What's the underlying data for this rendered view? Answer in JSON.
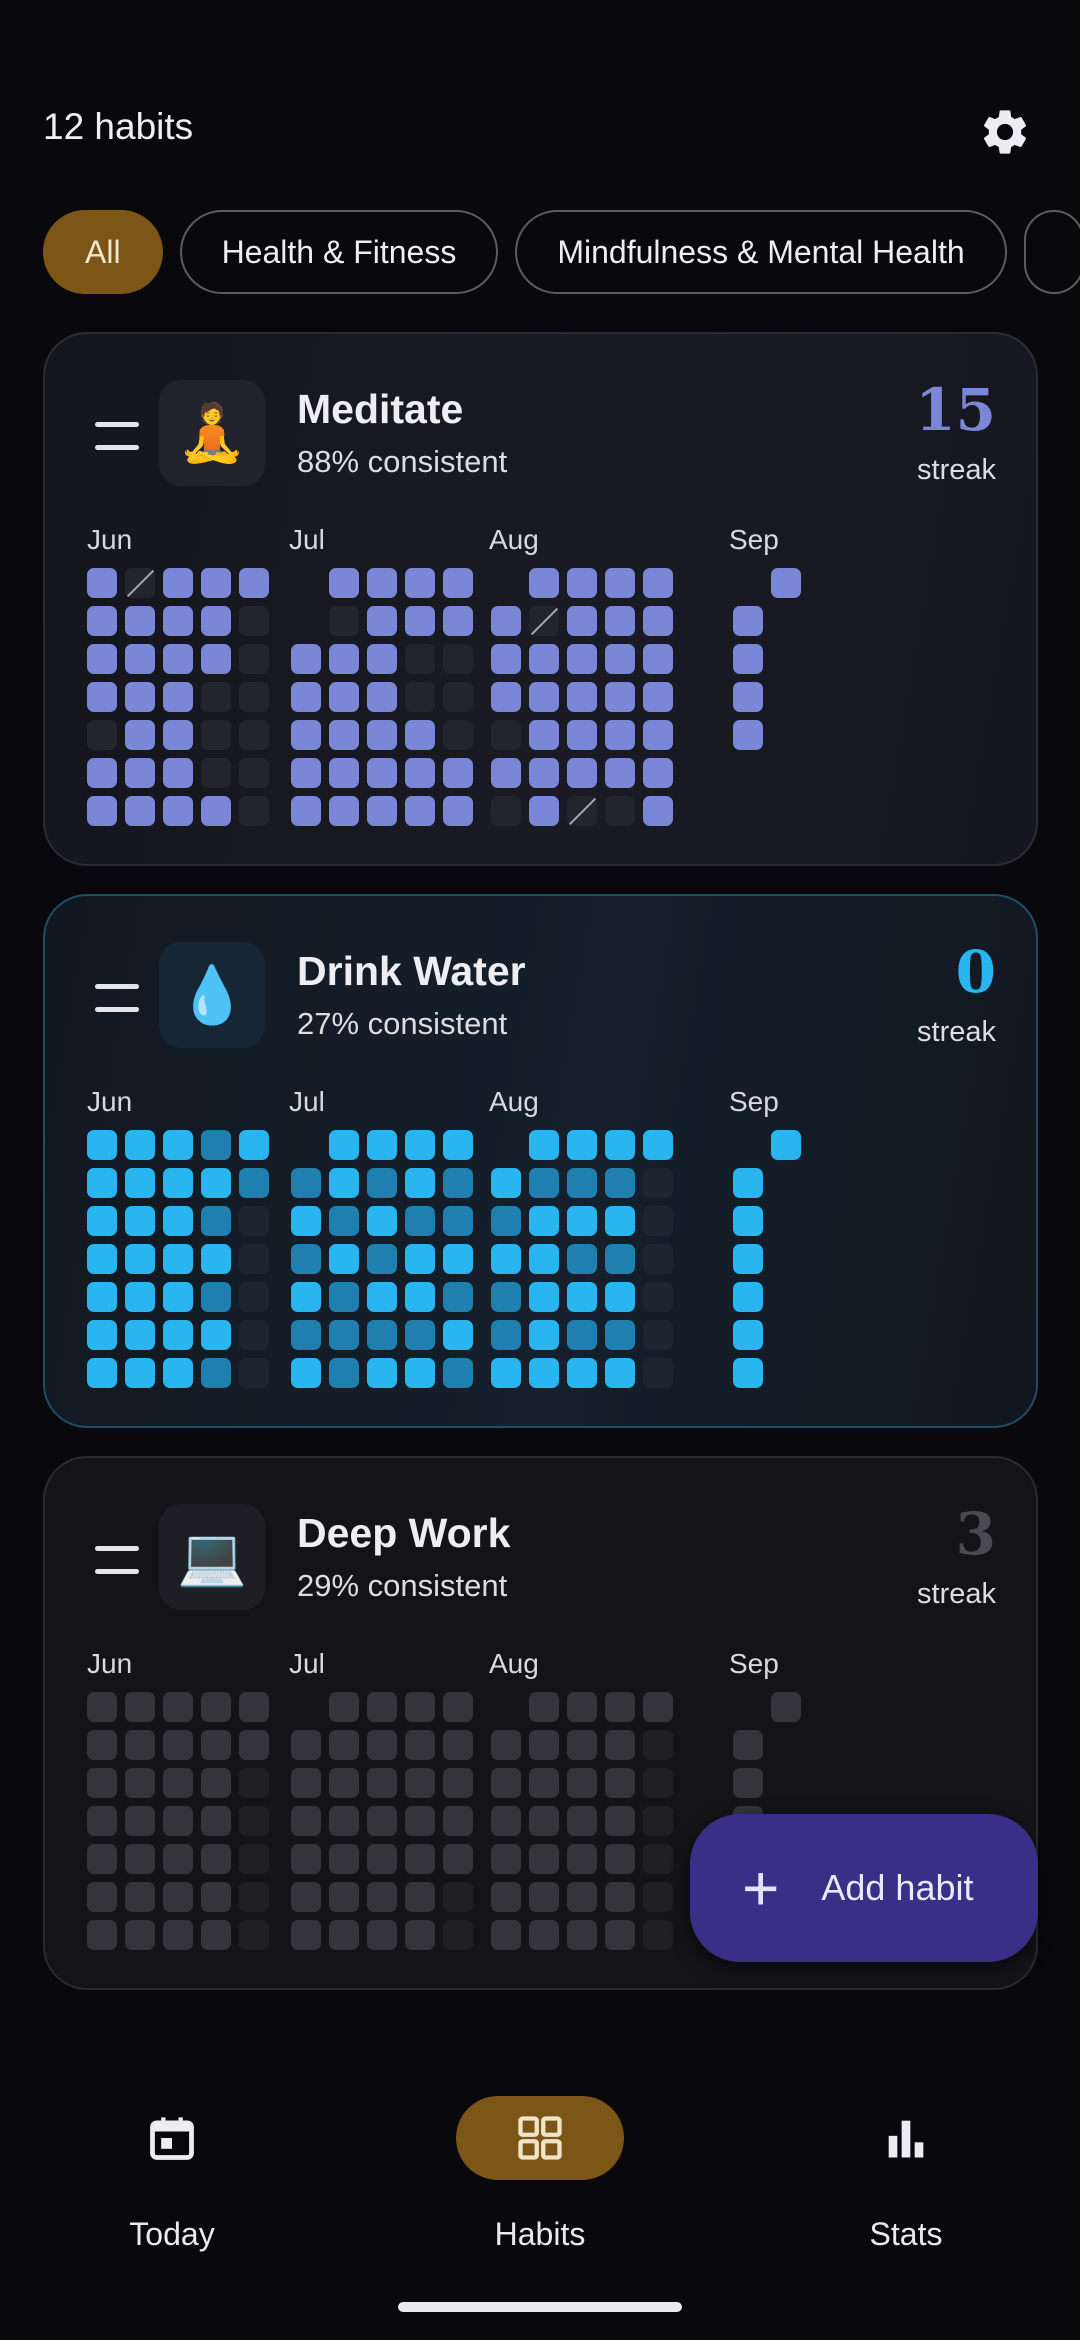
{
  "header": {
    "habit_count": "12 habits",
    "settings_icon": "gear-icon"
  },
  "filters": [
    {
      "label": "All",
      "active": true
    },
    {
      "label": "Health & Fitness",
      "active": false
    },
    {
      "label": "Mindfulness & Mental Health",
      "active": false
    }
  ],
  "months": [
    "Jun",
    "Jul",
    "Aug",
    "Sep"
  ],
  "habits": [
    {
      "name": "Meditate",
      "emoji": "🧘",
      "consistency": "88% consistent",
      "streak": "15",
      "streak_label": "streak",
      "accent": "#7a86d6"
    },
    {
      "name": "Drink Water",
      "emoji": "💧",
      "consistency": "27% consistent",
      "streak": "0",
      "streak_label": "streak",
      "accent": "#29b6f0"
    },
    {
      "name": "Deep Work",
      "emoji": "💻",
      "consistency": "29% consistent",
      "streak": "3",
      "streak_label": "streak",
      "accent": "#4a4a50"
    }
  ],
  "fab": {
    "label": "Add habit",
    "icon": "plus-icon"
  },
  "nav": [
    {
      "label": "Today",
      "icon": "calendar-icon",
      "active": false
    },
    {
      "label": "Habits",
      "icon": "grid-icon",
      "active": true
    },
    {
      "label": "Stats",
      "icon": "bar-chart-icon",
      "active": false
    }
  ]
}
